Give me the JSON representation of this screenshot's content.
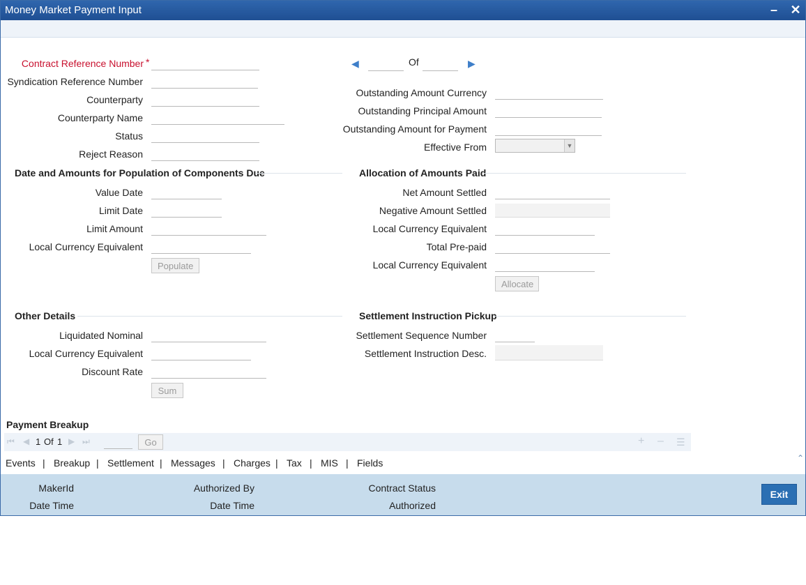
{
  "window": {
    "title": "Money Market Payment Input"
  },
  "header": {
    "contract_ref_label": "Contract Reference Number",
    "contract_ref_required": "*",
    "syndication_ref_label": "Syndication Reference Number",
    "counterparty_label": "Counterparty",
    "counterparty_name_label": "Counterparty Name",
    "status_label": "Status",
    "reject_reason_label": "Reject Reason",
    "pager_of": "Of",
    "outstanding_currency_label": "Outstanding Amount Currency",
    "outstanding_principal_label": "Outstanding Principal Amount",
    "outstanding_payment_label": "Outstanding Amount for Payment",
    "effective_from_label": "Effective From"
  },
  "components_due": {
    "title": "Date and Amounts for Population of Components Due",
    "value_date_label": "Value Date",
    "limit_date_label": "Limit Date",
    "limit_amount_label": "Limit Amount",
    "lcy_equivalent_label": "Local Currency Equivalent",
    "populate_button": "Populate"
  },
  "allocation": {
    "title": "Allocation of Amounts Paid",
    "net_amount_label": "Net Amount Settled",
    "negative_amount_label": "Negative Amount Settled",
    "lcy_equivalent_label": "Local Currency Equivalent",
    "total_prepaid_label": "Total Pre-paid",
    "lcy_equivalent2_label": "Local Currency Equivalent",
    "allocate_button": "Allocate"
  },
  "other_details": {
    "title": "Other Details",
    "liquidated_nominal_label": "Liquidated Nominal",
    "lcy_equivalent_label": "Local Currency Equivalent",
    "discount_rate_label": "Discount Rate",
    "sum_button": "Sum"
  },
  "settlement_pickup": {
    "title": "Settlement Instruction Pickup",
    "seq_number_label": "Settlement Sequence Number",
    "instruction_desc_label": "Settlement Instruction Desc."
  },
  "payment_breakup": {
    "title": "Payment Breakup",
    "page_current": "1",
    "page_of": "Of",
    "page_total": "1",
    "go_button": "Go"
  },
  "tabs": [
    "Events",
    "Breakup",
    "Settlement",
    "Messages",
    "Charges",
    "Tax",
    "MIS",
    "Fields"
  ],
  "tab_separator": "|",
  "footer": {
    "maker_id_label": "MakerId",
    "maker_date_label": "Date Time",
    "authorized_by_label": "Authorized By",
    "auth_date_label": "Date Time",
    "contract_status_label": "Contract Status",
    "auth_status_label": "Authorized",
    "exit_button": "Exit"
  },
  "colors": {
    "title_bar": "#2f66ad",
    "required_label": "#c8102e",
    "footer_bg": "#c7dcec",
    "exit_button": "#2b6fb3",
    "nav_arrow": "#3f7fc9"
  },
  "icons": [
    "minimize-icon",
    "close-icon",
    "prev-record-icon",
    "next-record-icon",
    "dropdown-arrow-icon",
    "first-page-icon",
    "prev-page-icon",
    "next-page-icon",
    "last-page-icon",
    "add-row-icon",
    "delete-row-icon",
    "single-view-icon",
    "collapse-icon"
  ]
}
